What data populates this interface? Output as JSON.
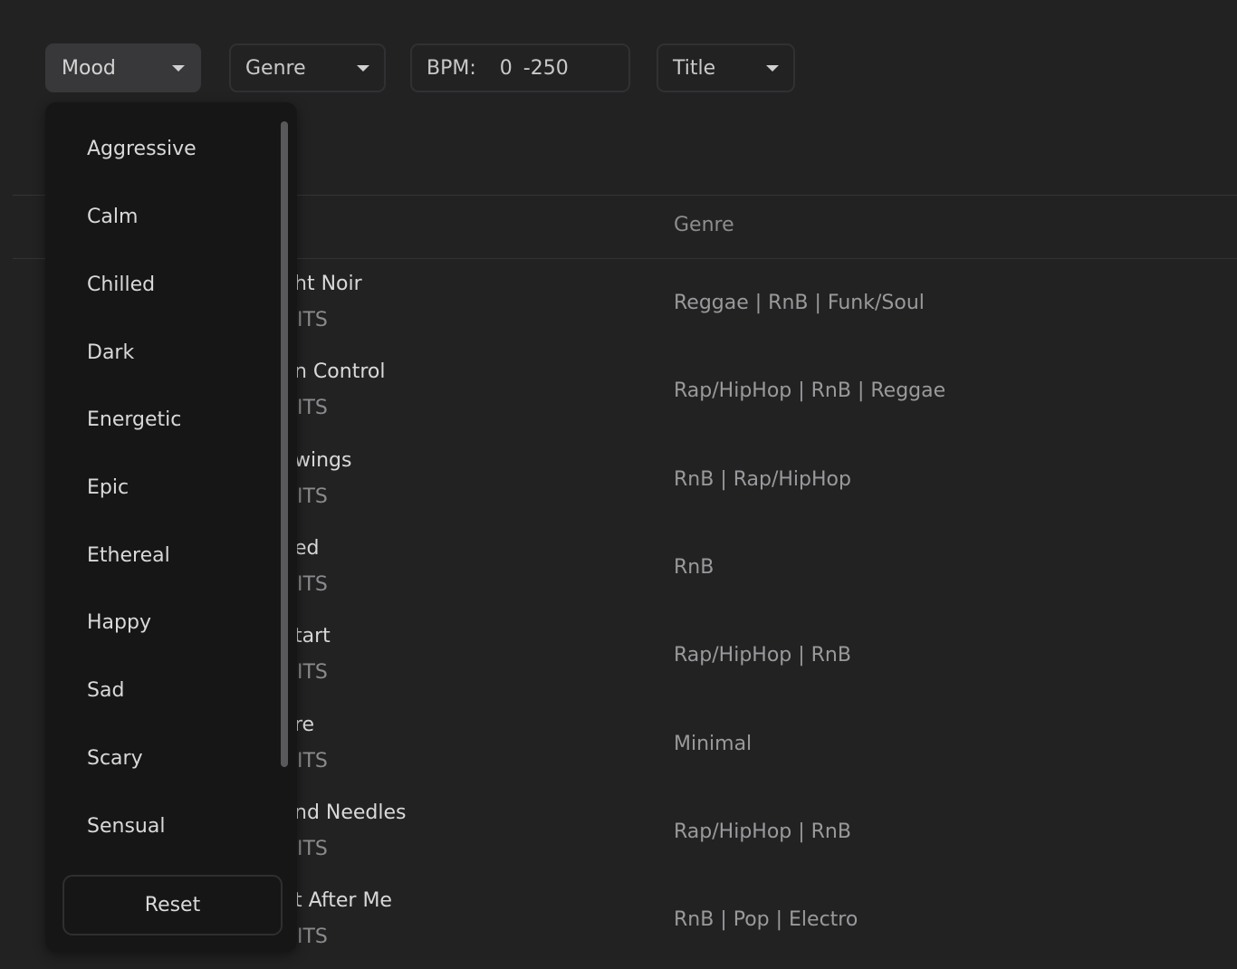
{
  "filters": {
    "mood": {
      "label": "Mood"
    },
    "genre": {
      "label": "Genre"
    },
    "bpm": {
      "label": "BPM:",
      "min": "0",
      "max": "-250"
    },
    "title": {
      "label": "Title"
    }
  },
  "table": {
    "genre_header": "Genre",
    "rows": [
      {
        "title": "ht Noir",
        "artist": "ITS",
        "genre": "Reggae | RnB | Funk/Soul"
      },
      {
        "title": "n Control",
        "artist": "ITS",
        "genre": "Rap/HipHop | RnB | Reggae"
      },
      {
        "title": "wings",
        "artist": "ITS",
        "genre": "RnB | Rap/HipHop"
      },
      {
        "title": "ed",
        "artist": "ITS",
        "genre": "RnB"
      },
      {
        "title": "tart",
        "artist": "ITS",
        "genre": "Rap/HipHop | RnB"
      },
      {
        "title": "re",
        "artist": "ITS",
        "genre": "Minimal"
      },
      {
        "title": "nd Needles",
        "artist": "ITS",
        "genre": "Rap/HipHop | RnB"
      },
      {
        "title": "t After Me",
        "artist": "ITS",
        "genre": "RnB | Pop | Electro"
      }
    ]
  },
  "mood_dropdown": {
    "options": [
      "Aggressive",
      "Calm",
      "Chilled",
      "Dark",
      "Energetic",
      "Epic",
      "Ethereal",
      "Happy",
      "Sad",
      "Scary",
      "Sensual"
    ],
    "reset_label": "Reset"
  },
  "icons": {
    "dropdown_caret": "chevron-down-icon"
  },
  "colors": {
    "background": "#222223",
    "dropdown_bg": "#161617",
    "active_filter_bg": "#38383a"
  }
}
